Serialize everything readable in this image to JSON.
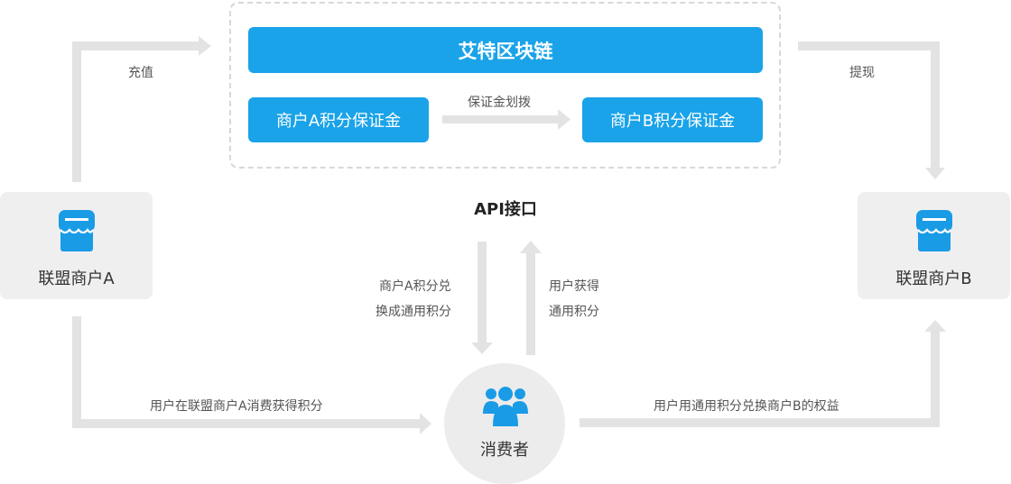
{
  "blockchain": {
    "title": "艾特区块链"
  },
  "deposits": {
    "a": "商户A积分保证金",
    "b": "商户B积分保证金",
    "transfer_label": "保证金划拨"
  },
  "merchant_a": {
    "label": "联盟商户A"
  },
  "merchant_b": {
    "label": "联盟商户B"
  },
  "flows": {
    "recharge": "充值",
    "withdraw": "提现",
    "api": "API接口",
    "to_points_line1": "商户A积分兑",
    "to_points_line2": "换成通用积分",
    "user_gets_line1": "用户获得",
    "user_gets_line2": "通用积分",
    "earn_points": "用户在联盟商户A消费获得积分",
    "redeem_points": "用户用通用积分兑换商户B的权益"
  },
  "consumer": {
    "label": "消费者"
  },
  "colors": {
    "accent": "#1aa3e8",
    "arrow": "#e3e3e3",
    "card_bg": "#efefef",
    "icon_blue": "#1a9be6"
  },
  "icons": {
    "store": "store-icon",
    "users": "users-icon"
  }
}
